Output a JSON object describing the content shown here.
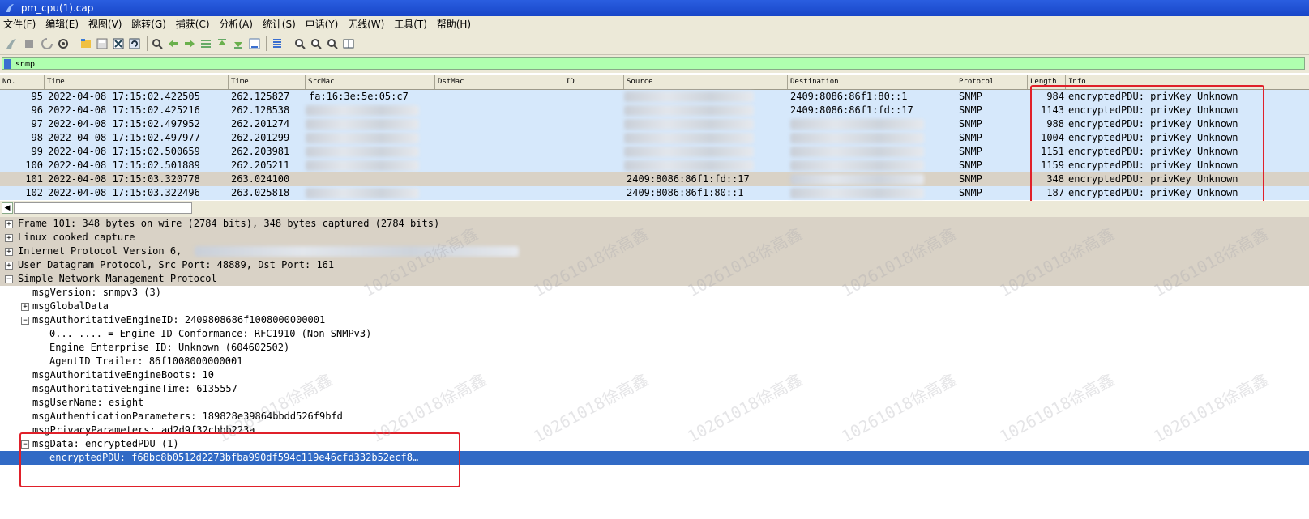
{
  "window": {
    "title": "pm_cpu(1).cap"
  },
  "menu": [
    "文件(F)",
    "编辑(E)",
    "视图(V)",
    "跳转(G)",
    "捕获(C)",
    "分析(A)",
    "统计(S)",
    "电话(Y)",
    "无线(W)",
    "工具(T)",
    "帮助(H)"
  ],
  "toolbar_icons": [
    "shark-fin-start-icon",
    "stop-icon",
    "restart-icon",
    "options-icon",
    "open-file-icon",
    "save-file-icon",
    "close-file-icon",
    "reload-icon",
    "find-icon",
    "back-icon",
    "forward-icon",
    "goto-packet-icon",
    "first-packet-icon",
    "last-packet-icon",
    "autoscroll-icon",
    "colorize-icon",
    "zoom-in-icon",
    "zoom-out-icon",
    "zoom-normal-icon",
    "resize-columns-icon"
  ],
  "filter": {
    "value": "snmp"
  },
  "packet_list": {
    "columns": [
      "No.",
      "Time",
      "Time",
      "SrcMac",
      "DstMac",
      "ID",
      "Source",
      "Destination",
      "Protocol",
      "Length",
      "Info"
    ],
    "rows": [
      {
        "no": "95",
        "time": "2022-04-08 17:15:02.422505",
        "rel": "262.125827",
        "srcmac": "fa:16:3e:5e:05:c7",
        "source": "",
        "destination": "2409:8086:86f1:80::1",
        "protocol": "SNMP",
        "length": "984",
        "info": "encryptedPDU: privKey Unknown",
        "selected": false
      },
      {
        "no": "96",
        "time": "2022-04-08 17:15:02.425216",
        "rel": "262.128538",
        "srcmac": "",
        "source": "",
        "destination": "2409:8086:86f1:fd::17",
        "protocol": "SNMP",
        "length": "1143",
        "info": "encryptedPDU: privKey Unknown",
        "selected": false
      },
      {
        "no": "97",
        "time": "2022-04-08 17:15:02.497952",
        "rel": "262.201274",
        "srcmac": "",
        "source": "",
        "destination": "",
        "protocol": "SNMP",
        "length": "988",
        "info": "encryptedPDU: privKey Unknown",
        "selected": false
      },
      {
        "no": "98",
        "time": "2022-04-08 17:15:02.497977",
        "rel": "262.201299",
        "srcmac": "",
        "source": "",
        "destination": "",
        "protocol": "SNMP",
        "length": "1004",
        "info": "encryptedPDU: privKey Unknown",
        "selected": false
      },
      {
        "no": "99",
        "time": "2022-04-08 17:15:02.500659",
        "rel": "262.203981",
        "srcmac": "",
        "source": "",
        "destination": "",
        "protocol": "SNMP",
        "length": "1151",
        "info": "encryptedPDU: privKey Unknown",
        "selected": false
      },
      {
        "no": "100",
        "time": "2022-04-08 17:15:02.501889",
        "rel": "262.205211",
        "srcmac": "",
        "source": "",
        "destination": "",
        "protocol": "SNMP",
        "length": "1159",
        "info": "encryptedPDU: privKey Unknown",
        "selected": false
      },
      {
        "no": "101",
        "time": "2022-04-08 17:15:03.320778",
        "rel": "263.024100",
        "srcmac": "",
        "source": "2409:8086:86f1:fd::17",
        "destination": "",
        "protocol": "SNMP",
        "length": "348",
        "info": "encryptedPDU: privKey Unknown",
        "selected": true
      },
      {
        "no": "102",
        "time": "2022-04-08 17:15:03.322496",
        "rel": "263.025818",
        "srcmac": "",
        "source": "2409:8086:86f1:80::1",
        "destination": "",
        "protocol": "SNMP",
        "length": "187",
        "info": "encryptedPDU: privKey Unknown",
        "selected": false
      }
    ]
  },
  "details": [
    {
      "text": "Frame 101: 348 bytes on wire (2784 bits), 348 bytes captured (2784 bits)",
      "expander": "+",
      "style": "grey"
    },
    {
      "text": "Linux cooked capture",
      "expander": "+",
      "style": "grey"
    },
    {
      "text": "Internet Protocol Version 6,",
      "expander": "+",
      "style": "grey"
    },
    {
      "text": "User Datagram Protocol, Src Port: 48889, Dst Port: 161",
      "expander": "+",
      "style": "grey"
    },
    {
      "text": "Simple Network Management Protocol",
      "expander": "-",
      "style": "grey"
    },
    {
      "text": "msgVersion: snmpv3 (3)",
      "expander": "",
      "style": ""
    },
    {
      "text": "msgGlobalData",
      "expander": "+",
      "style": ""
    },
    {
      "text": "msgAuthoritativeEngineID: 2409808686f1008000000001",
      "expander": "-",
      "style": ""
    },
    {
      "text": "0... .... = Engine ID Conformance: RFC1910 (Non-SNMPv3)",
      "expander": "",
      "style": ""
    },
    {
      "text": "Engine Enterprise ID: Unknown (604602502)",
      "expander": "",
      "style": ""
    },
    {
      "text": "AgentID Trailer: 86f1008000000001",
      "expander": "",
      "style": ""
    },
    {
      "text": "msgAuthoritativeEngineBoots: 10",
      "expander": "",
      "style": ""
    },
    {
      "text": "msgAuthoritativeEngineTime: 6135557",
      "expander": "",
      "style": ""
    },
    {
      "text": "msgUserName: esight",
      "expander": "",
      "style": ""
    },
    {
      "text": "msgAuthenticationParameters: 189828e39864bbdd526f9bfd",
      "expander": "",
      "style": ""
    },
    {
      "text": "msgPrivacyParameters: ad2d9f32cbbb223a",
      "expander": "",
      "style": ""
    },
    {
      "text": "msgData: encryptedPDU (1)",
      "expander": "-",
      "style": ""
    },
    {
      "text": "encryptedPDU: f68bc8b0512d2273bfba990df594c119e46cfd332b52ecf8…",
      "expander": "",
      "style": "hl"
    }
  ],
  "watermark": "10261018徐高鑫",
  "colors": {
    "row_bg": "#d6e8fb",
    "selected_row": "#d9d2c6",
    "highlight": "#316ac5",
    "filter_bg": "#afffaf",
    "annotation": "#e0202a"
  }
}
